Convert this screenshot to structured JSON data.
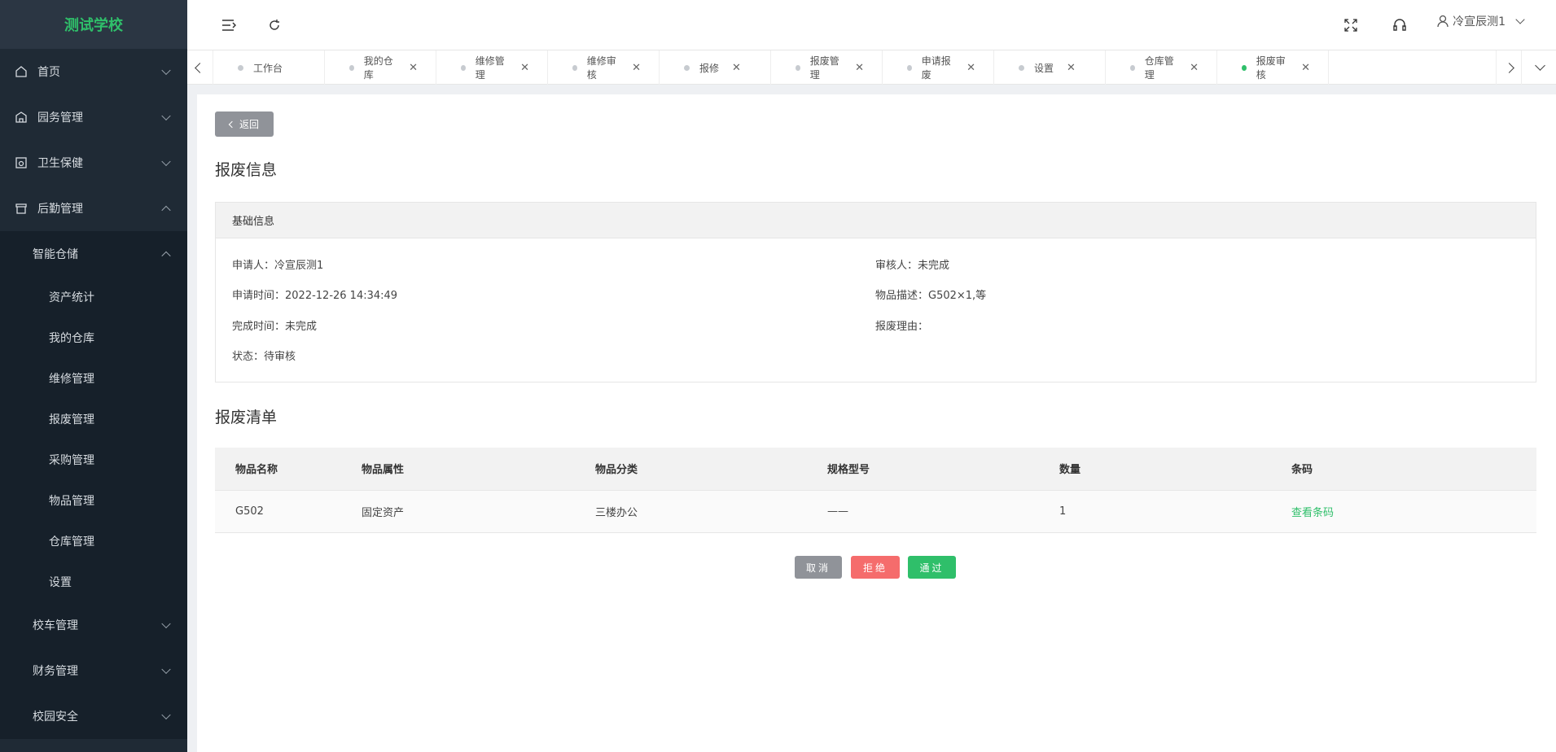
{
  "sidebar": {
    "logo": "测试学校",
    "menu": {
      "home": "首页",
      "campus": "园务管理",
      "health": "卫生保健",
      "logistics": "后勤管理",
      "smart_storage": "智能仓储",
      "asset_stats": "资产统计",
      "my_warehouse": "我的仓库",
      "repair_mgmt": "维修管理",
      "scrap_mgmt": "报废管理",
      "purchase_mgmt": "采购管理",
      "item_mgmt": "物品管理",
      "warehouse_mgmt": "仓库管理",
      "settings": "设置",
      "bus_mgmt": "校车管理",
      "finance_mgmt": "财务管理",
      "campus_safety": "校园安全"
    }
  },
  "header": {
    "user_name": "冷宣辰测1"
  },
  "tabs": [
    {
      "label": "工作台",
      "closable": false,
      "active": false
    },
    {
      "label": "我的仓库",
      "closable": true,
      "active": false
    },
    {
      "label": "维修管理",
      "closable": true,
      "active": false
    },
    {
      "label": "维修审核",
      "closable": true,
      "active": false
    },
    {
      "label": "报修",
      "closable": true,
      "active": false
    },
    {
      "label": "报废管理",
      "closable": true,
      "active": false
    },
    {
      "label": "申请报废",
      "closable": true,
      "active": false
    },
    {
      "label": "设置",
      "closable": true,
      "active": false
    },
    {
      "label": "仓库管理",
      "closable": true,
      "active": false
    },
    {
      "label": "报废审核",
      "closable": true,
      "active": true
    }
  ],
  "main": {
    "back_label": "返回",
    "info_title": "报废信息",
    "basic_info_label": "基础信息",
    "applicant": "申请人：冷宣辰测1",
    "reviewer": "审核人：未完成",
    "apply_time": "申请时间：2022-12-26 14:34:49",
    "item_desc": "物品描述：G502×1,等",
    "finish_time": "完成时间：未完成",
    "scrap_reason": "报废理由：",
    "status": "状态：待审核",
    "list_title": "报废清单",
    "table": {
      "headers": [
        "物品名称",
        "物品属性",
        "物品分类",
        "规格型号",
        "数量",
        "条码"
      ],
      "rows": [
        [
          "G502",
          "固定资产",
          "三楼办公",
          "——",
          "1",
          "查看条码"
        ]
      ]
    },
    "buttons": {
      "cancel": "取消",
      "reject": "拒绝",
      "approve": "通过"
    },
    "colors": {
      "accent": "#2fbf6a",
      "reject": "#f56c6c",
      "cancel": "#909399"
    }
  }
}
